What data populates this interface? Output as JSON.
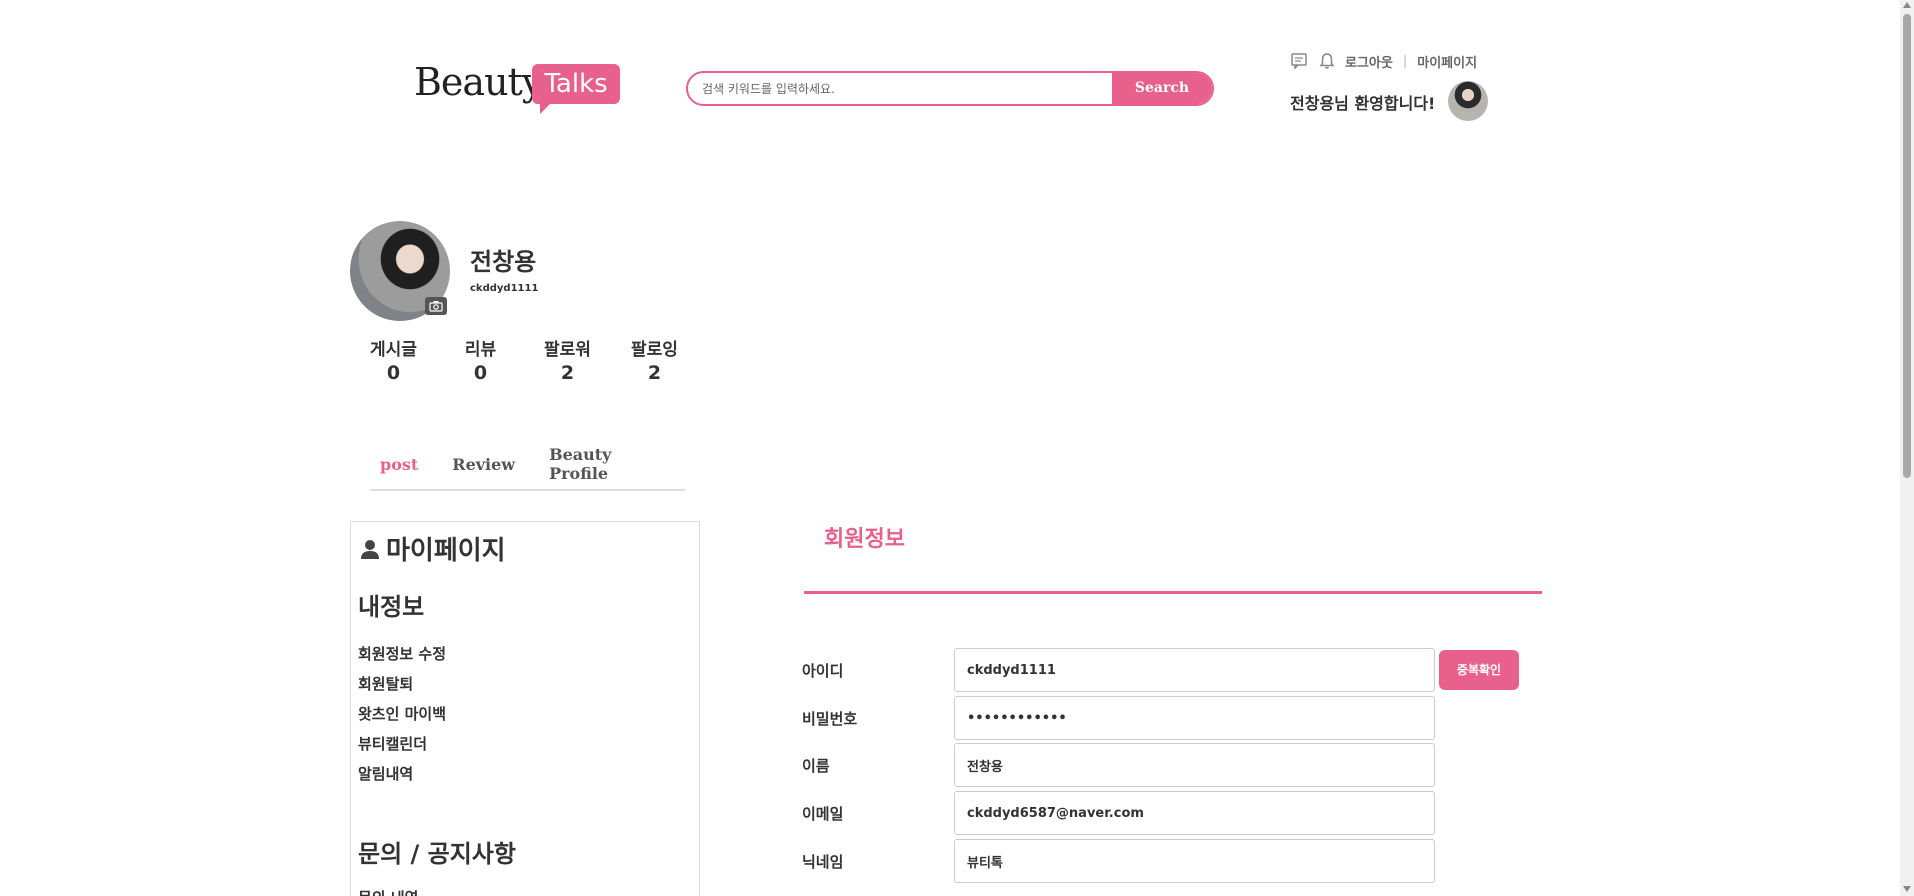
{
  "header": {
    "logo_word": "Beauty",
    "logo_bubble": "Talks",
    "search_placeholder": "검색 키워드를 입력하세요.",
    "search_button": "Search",
    "logout": "로그아웃",
    "separator": "|",
    "mypage": "마이페이지",
    "welcome": "전창용님 환영합니다!"
  },
  "icons": {
    "chat": "chat-icon",
    "bell": "bell-icon",
    "camera": "camera-icon",
    "user": "user-icon"
  },
  "profile": {
    "name": "전창용",
    "id": "ckddyd1111",
    "stats": [
      {
        "label": "게시글",
        "value": "0"
      },
      {
        "label": "리뷰",
        "value": "0"
      },
      {
        "label": "팔로워",
        "value": "2"
      },
      {
        "label": "팔로잉",
        "value": "2"
      }
    ]
  },
  "tabs": [
    "post",
    "Review",
    "Beauty Profile"
  ],
  "sidebar": {
    "title": "마이페이지",
    "section1": "내정보",
    "items1": [
      "회원정보 수정",
      "회원탈퇴",
      "왓츠인 마이백",
      "뷰티캘린더",
      "알림내역"
    ],
    "section2": "문의 / 공지사항",
    "items2": [
      "문의 내역"
    ]
  },
  "form": {
    "title": "회원정보",
    "fields": [
      {
        "label": "아이디",
        "value": "ckddyd1111"
      },
      {
        "label": "비밀번호",
        "value": "••••••••••••"
      },
      {
        "label": "이름",
        "value": "전창용"
      },
      {
        "label": "이메일",
        "value": "ckddyd6587@naver.com"
      },
      {
        "label": "닉네임",
        "value": "뷰티톡"
      }
    ],
    "dup_button": "중복확인"
  },
  "colors": {
    "accent": "#e8618c",
    "text": "#333333"
  }
}
